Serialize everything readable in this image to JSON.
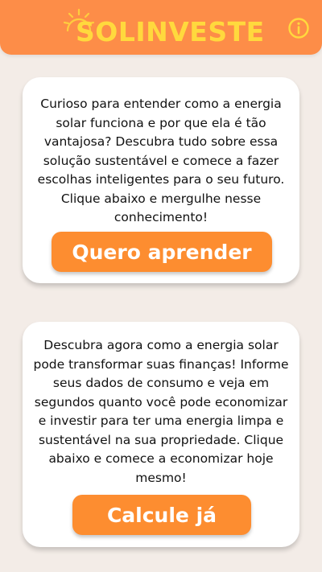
{
  "header": {
    "logo_text": "SOLINVESTE",
    "logo_icon": "sun-icon",
    "info_icon": "info-icon"
  },
  "cards": [
    {
      "text": "Curioso para entender como a energia solar funciona e por que ela é tão vantajosa? Descubra tudo sobre essa solução sustentável e comece a fazer escolhas inteligentes para o seu futuro. Clique abaixo e mergulhe nesse conhecimento!",
      "button_label": "Quero aprender"
    },
    {
      "text": "Descubra agora como a energia solar pode transformar suas finanças! Informe seus dados de consumo e veja em segundos quanto você pode economizar e investir para ter uma energia limpa e sustentável na sua propriedade. Clique abaixo e comece a economizar hoje mesmo!",
      "button_label": "Calcule já"
    }
  ],
  "colors": {
    "header_bg": "#fd8d48",
    "logo_yellow": "#ffd93d",
    "button_bg": "#fd8d30",
    "page_bg": "#f3ece7"
  }
}
